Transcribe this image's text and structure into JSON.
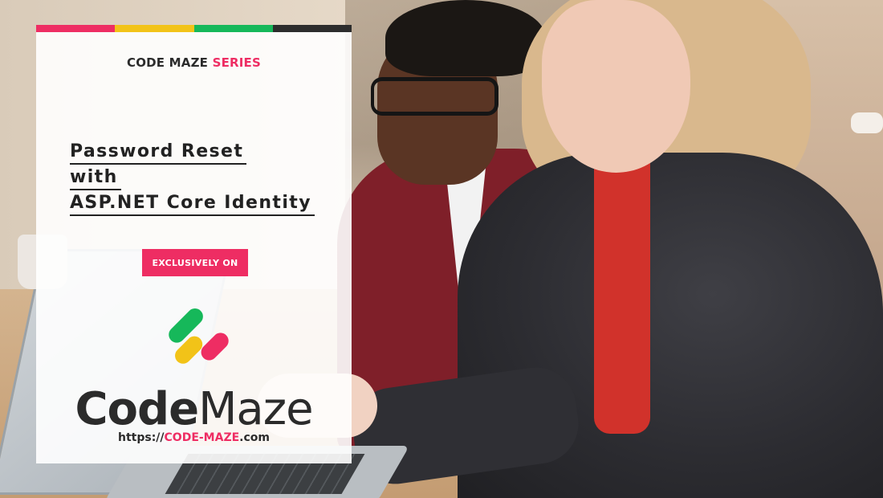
{
  "theme": {
    "accent": "#ee2d63",
    "dark_text": "#2b2b2b",
    "stripe_colors": [
      "#ee2d63",
      "#f2c318",
      "#16b85a",
      "#2d2d2d"
    ]
  },
  "series": {
    "prefix": "CODE MAZE",
    "suffix": "SERIES"
  },
  "article": {
    "title_lines": [
      "Password Reset",
      "with",
      "ASP.NET Core Identity"
    ]
  },
  "badge": {
    "label": "EXCLUSIVELY ON"
  },
  "brand": {
    "logo_icon": "code-maze-logo-icon",
    "name_part1": "Code",
    "name_part2": "Maze",
    "url_prefix": "https://",
    "url_brand": "CODE-MAZE",
    "url_suffix": ".com"
  }
}
